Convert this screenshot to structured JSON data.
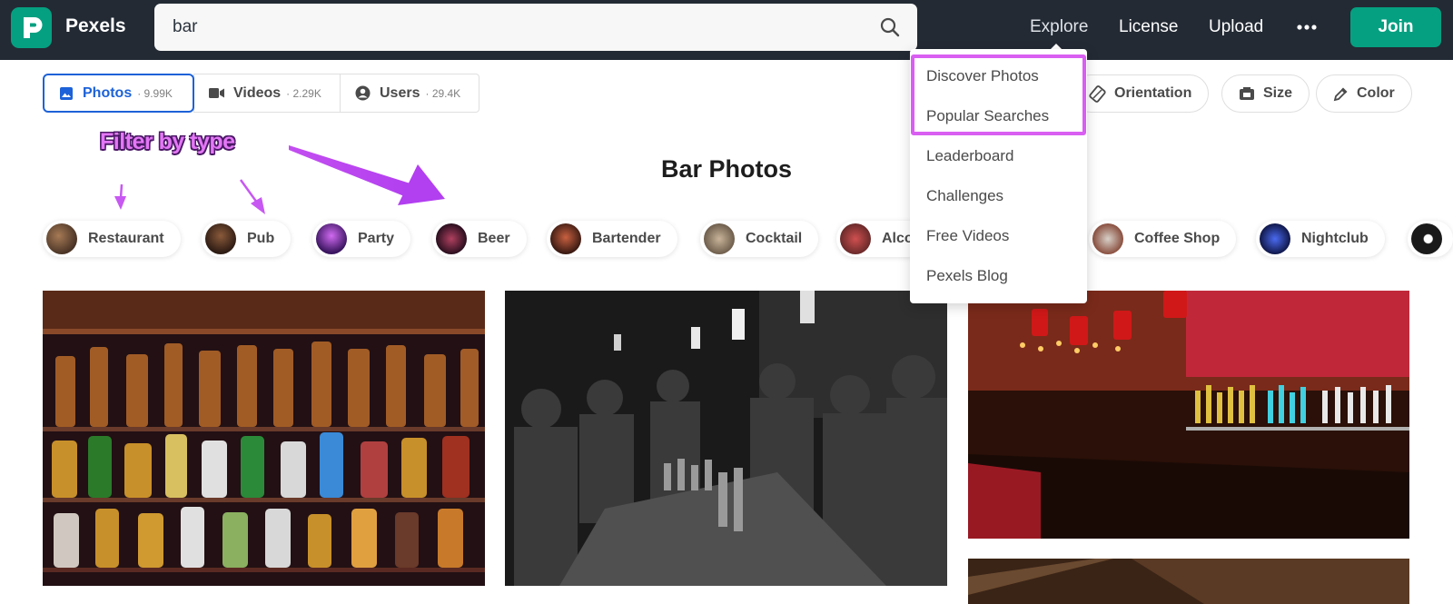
{
  "header": {
    "brand": "Pexels",
    "search": {
      "value": "bar"
    },
    "nav": {
      "explore": "Explore",
      "license": "License",
      "upload": "Upload",
      "join": "Join"
    }
  },
  "tabs": [
    {
      "label": "Photos",
      "count": "· 9.99K",
      "icon": "image-icon"
    },
    {
      "label": "Videos",
      "count": "· 2.29K",
      "icon": "video-icon"
    },
    {
      "label": "Users",
      "count": "· 29.4K",
      "icon": "user-icon"
    }
  ],
  "filters": {
    "orientation": "Orientation",
    "size": "Size",
    "color": "Color"
  },
  "annotation": {
    "text": "Filter by type",
    "color": "#e477f6"
  },
  "page_title": "Bar Photos",
  "chips": [
    "Restaurant",
    "Pub",
    "Party",
    "Beer",
    "Bartender",
    "Cocktail",
    "Alco",
    "Coffee Shop",
    "Nightclub"
  ],
  "explore_menu": {
    "items": [
      "Discover Photos",
      "Popular Searches",
      "Leaderboard",
      "Challenges",
      "Free Videos",
      "Pexels Blog"
    ],
    "highlight_color": "#d95ef2"
  },
  "colors": {
    "accent": "#05a081",
    "topbar": "#232a34",
    "active_tab": "#1d62d8"
  }
}
